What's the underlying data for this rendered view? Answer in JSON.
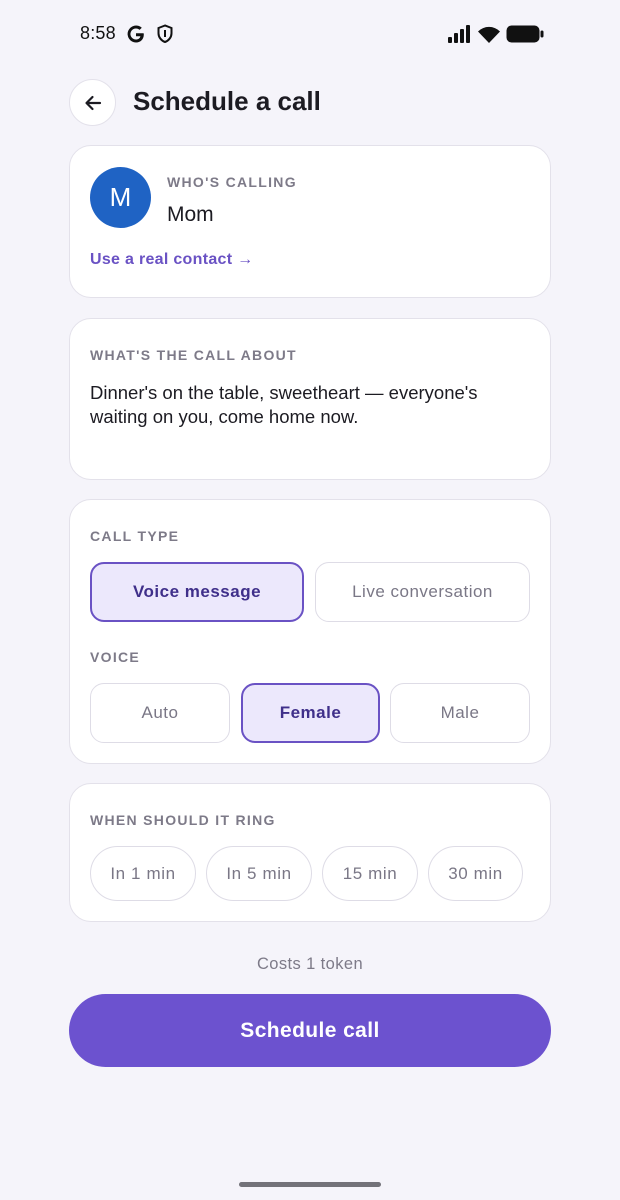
{
  "status_bar": {
    "time": "8:58",
    "icons": [
      "google-icon",
      "shield-icon",
      "signal-icon",
      "wifi-icon",
      "battery-icon"
    ]
  },
  "header": {
    "back_icon": "arrow-left-icon",
    "title": "Schedule a call"
  },
  "caller": {
    "label": "WHO'S CALLING",
    "avatar_letter": "M",
    "avatar_color": "#1f63c4",
    "name": "Mom",
    "real_contact_link": "Use a real contact →"
  },
  "about": {
    "label": "WHAT'S THE CALL ABOUT",
    "message": "Dinner's on the table, sweetheart — everyone's waiting on you, come home now."
  },
  "call_type": {
    "label": "CALL TYPE",
    "options": [
      "Voice message",
      "Live conversation"
    ],
    "selected": "Voice message"
  },
  "voice": {
    "label": "VOICE",
    "options": [
      "Auto",
      "Female",
      "Male"
    ],
    "selected": "Female"
  },
  "timing": {
    "label": "WHEN SHOULD IT RING",
    "options": [
      "In 1 min",
      "In 5 min",
      "15 min",
      "30 min"
    ]
  },
  "footer": {
    "cost": "Costs 1 token",
    "schedule_button": "Schedule call"
  },
  "colors": {
    "accent": "#6c52cf",
    "selected_bg": "#ece8fc",
    "background": "#f5f4fa"
  }
}
